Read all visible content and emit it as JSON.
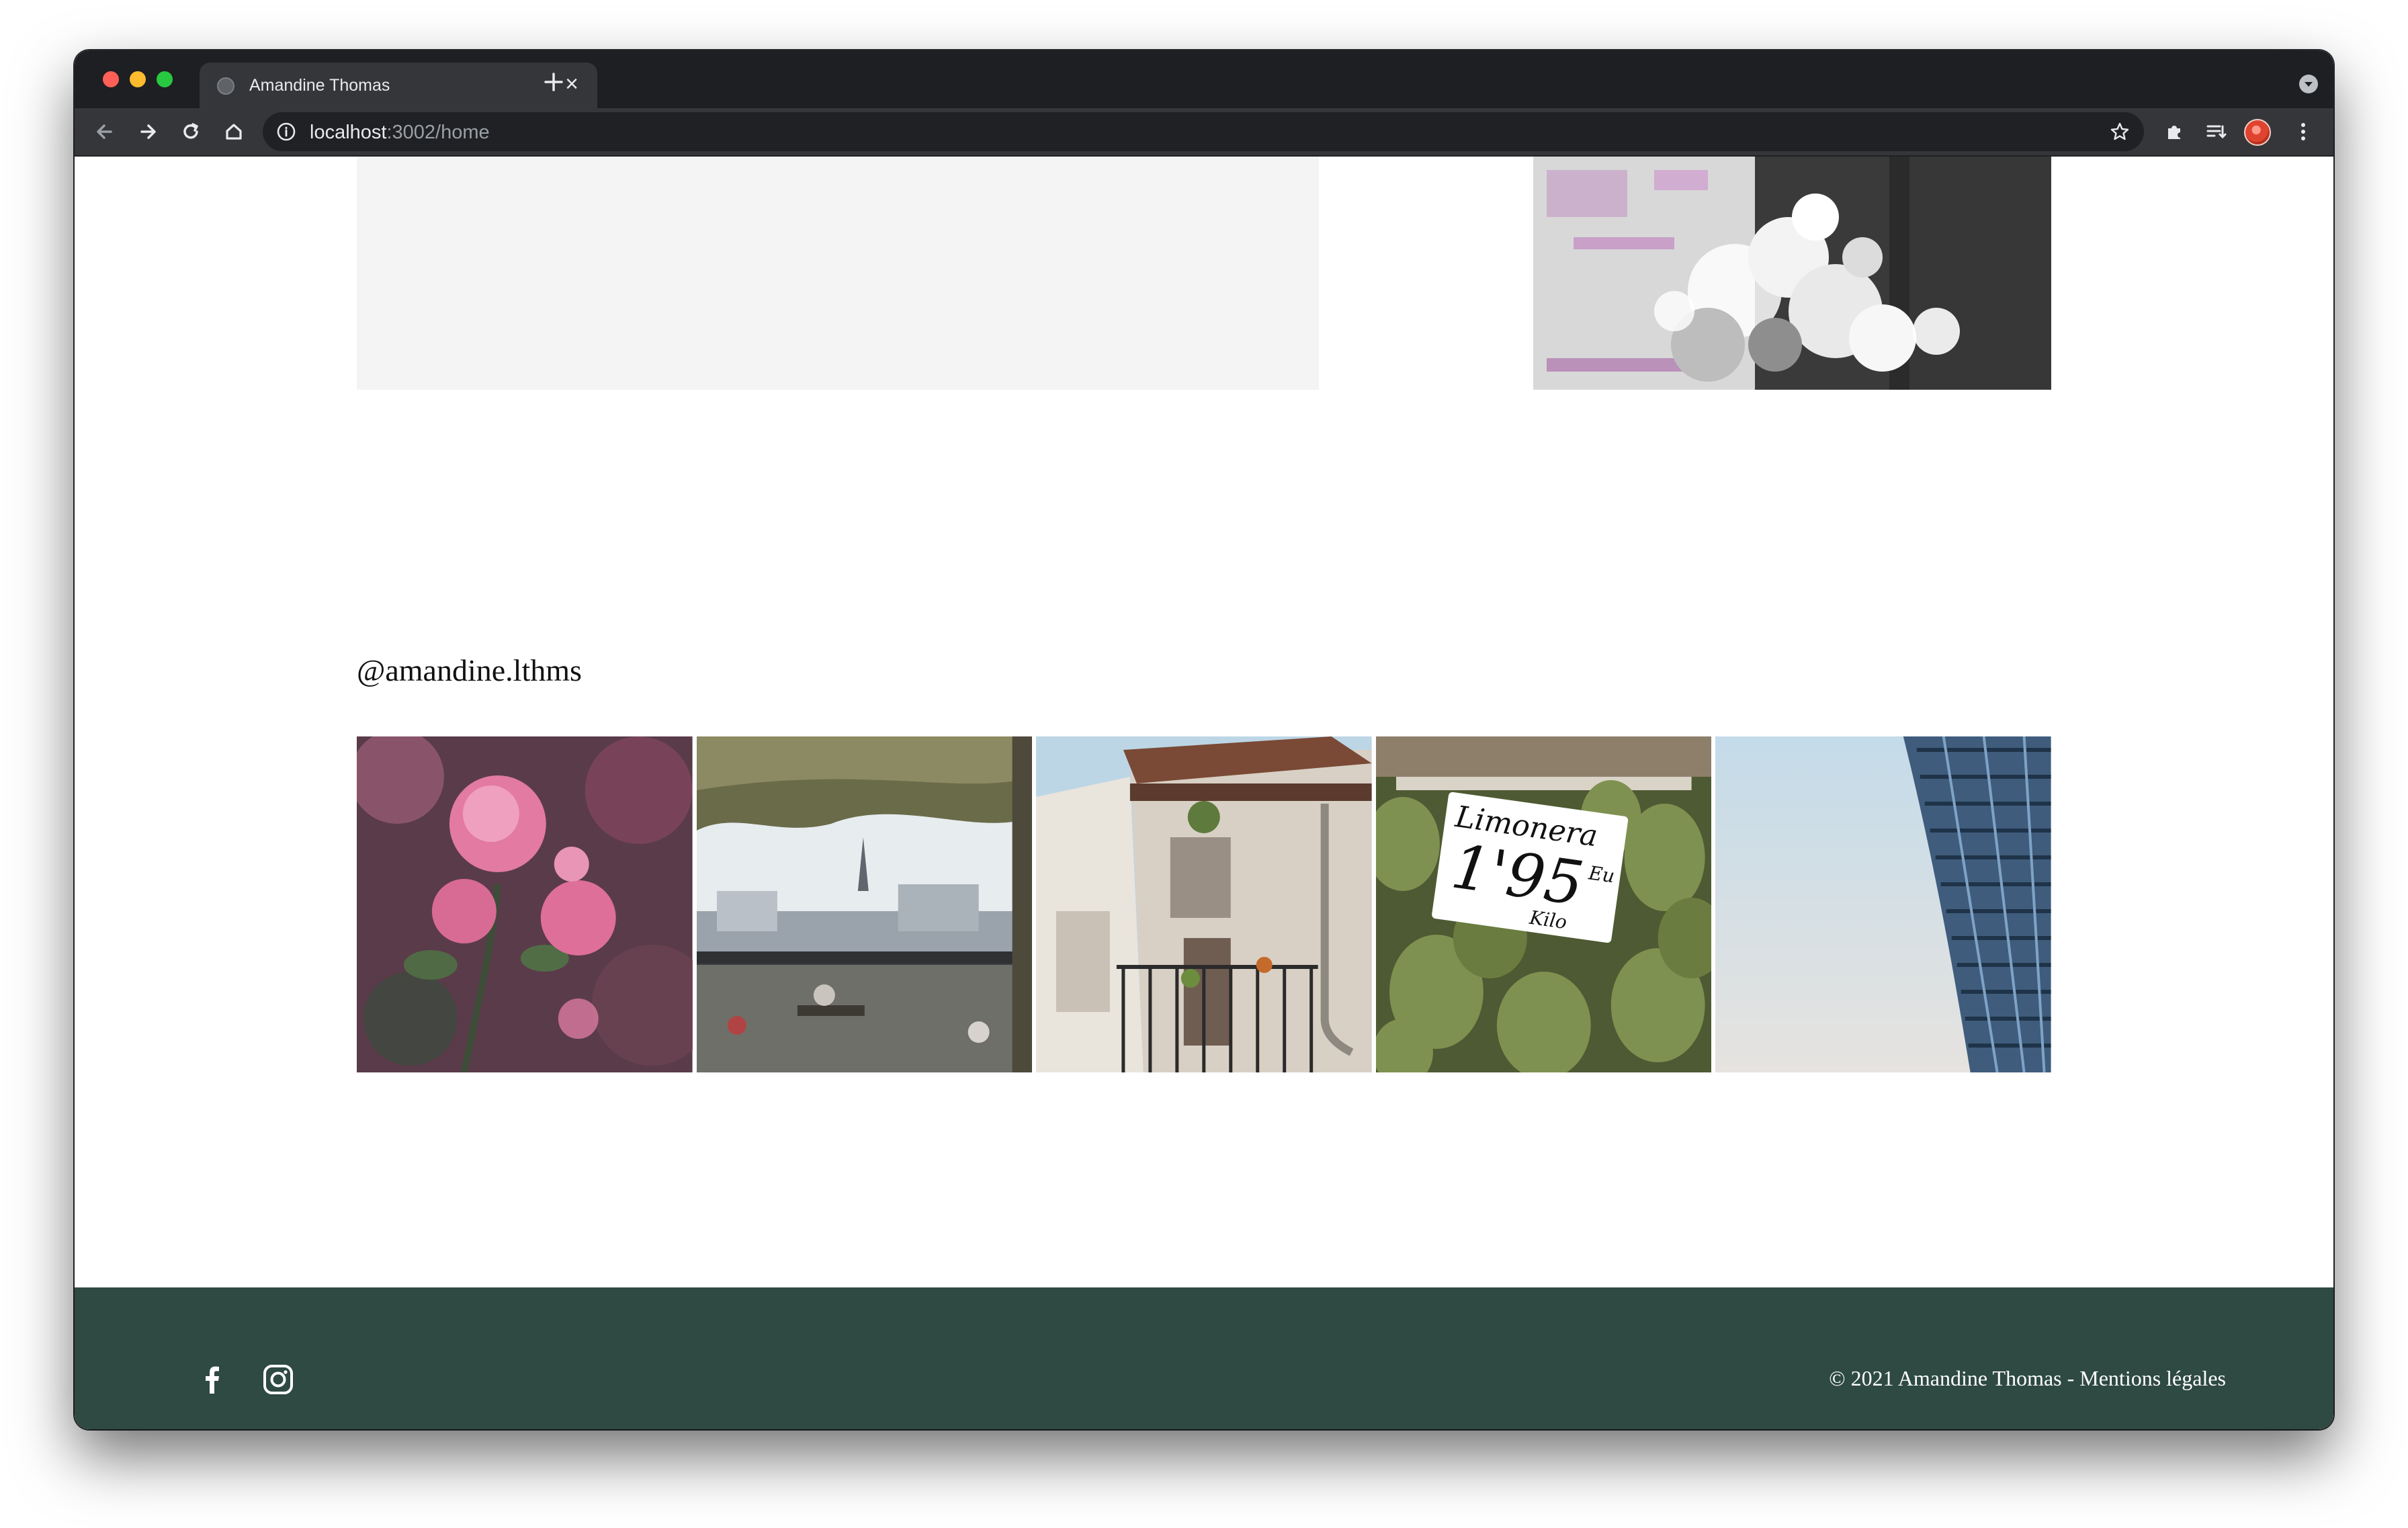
{
  "browser": {
    "tab_title": "Amandine Thomas",
    "url_host": "localhost",
    "url_path": ":3002/home"
  },
  "instagram": {
    "handle": "@amandine.lthms",
    "photos": [
      "pink-roses",
      "paris-view-eiffel-tower",
      "old-building-balcony",
      "pears-market-sign",
      "modern-building-facade"
    ],
    "price_sign": {
      "line1": "Limonera",
      "line2": "1'95",
      "unit": "Eu",
      "line3": "Kilo"
    }
  },
  "footer": {
    "copyright": "© 2021 Amandine Thomas - Mentions légales",
    "background": "#2e4a42"
  }
}
